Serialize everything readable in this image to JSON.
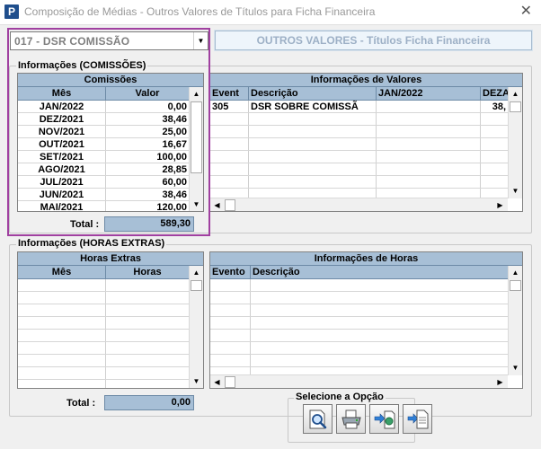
{
  "window": {
    "title": "Composição de Médias - Outros Valores de Títulos para Ficha Financeira",
    "app_icon": "P",
    "close_glyph": "✕"
  },
  "combo": {
    "value": "017 - DSR COMISSÃO"
  },
  "header_banner": "OUTROS VALORES - Títulos Ficha Financeira",
  "comissoes_group": {
    "label": "Informações (COMISSÕES)",
    "grid_caption": "Comissões",
    "columns": [
      "Mês",
      "Valor"
    ],
    "rows": [
      [
        "JAN/2022",
        "0,00"
      ],
      [
        "DEZ/2021",
        "38,46"
      ],
      [
        "NOV/2021",
        "25,00"
      ],
      [
        "OUT/2021",
        "16,67"
      ],
      [
        "SET/2021",
        "100,00"
      ],
      [
        "AGO/2021",
        "28,85"
      ],
      [
        "JUL/2021",
        "60,00"
      ],
      [
        "JUN/2021",
        "38,46"
      ],
      [
        "MAI/2021",
        "120,00"
      ]
    ],
    "total_label": "Total :",
    "total_value": "589,30"
  },
  "valores_grid": {
    "caption": "Informações de Valores",
    "columns": [
      "Event",
      "Descrição",
      "JAN/2022",
      "DEZA"
    ],
    "rows": [
      [
        "305",
        "DSR SOBRE COMISSÃ",
        "",
        "38,"
      ]
    ]
  },
  "horas_group": {
    "label": "Informações (HORAS EXTRAS)",
    "grid_caption": "Horas Extras",
    "columns": [
      "Mês",
      "Horas"
    ],
    "total_label": "Total :",
    "total_value": "0,00"
  },
  "horas_grid": {
    "caption": "Informações de Horas",
    "columns": [
      "Evento",
      "Descrição"
    ]
  },
  "options_group": {
    "label": "Selecione a Opção"
  },
  "icons": {
    "combo_arrow": "▼",
    "scroll_up": "▲",
    "scroll_down": "▼",
    "scroll_left": "◀",
    "scroll_right": "▶"
  },
  "colors": {
    "grid_header": "#a7bfd6",
    "highlight_frame": "#a040a0"
  }
}
